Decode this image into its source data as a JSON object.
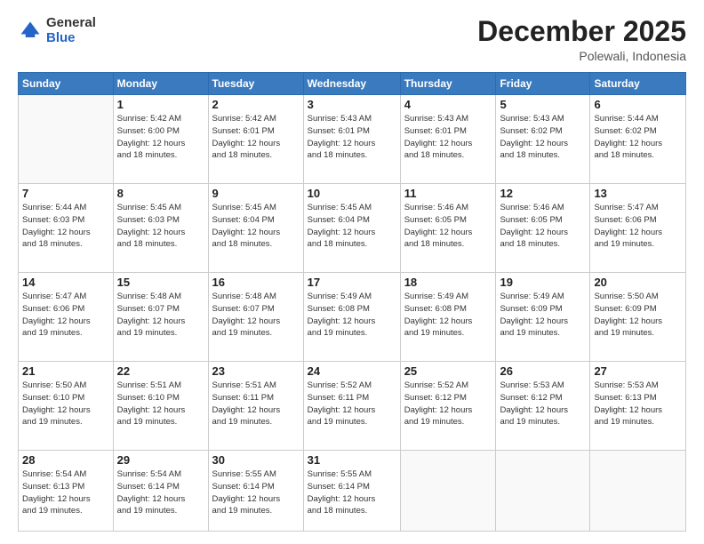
{
  "logo": {
    "general": "General",
    "blue": "Blue"
  },
  "header": {
    "month": "December 2025",
    "location": "Polewali, Indonesia"
  },
  "days_header": [
    "Sunday",
    "Monday",
    "Tuesday",
    "Wednesday",
    "Thursday",
    "Friday",
    "Saturday"
  ],
  "weeks": [
    [
      {
        "day": "",
        "info": ""
      },
      {
        "day": "1",
        "info": "Sunrise: 5:42 AM\nSunset: 6:00 PM\nDaylight: 12 hours\nand 18 minutes."
      },
      {
        "day": "2",
        "info": "Sunrise: 5:42 AM\nSunset: 6:01 PM\nDaylight: 12 hours\nand 18 minutes."
      },
      {
        "day": "3",
        "info": "Sunrise: 5:43 AM\nSunset: 6:01 PM\nDaylight: 12 hours\nand 18 minutes."
      },
      {
        "day": "4",
        "info": "Sunrise: 5:43 AM\nSunset: 6:01 PM\nDaylight: 12 hours\nand 18 minutes."
      },
      {
        "day": "5",
        "info": "Sunrise: 5:43 AM\nSunset: 6:02 PM\nDaylight: 12 hours\nand 18 minutes."
      },
      {
        "day": "6",
        "info": "Sunrise: 5:44 AM\nSunset: 6:02 PM\nDaylight: 12 hours\nand 18 minutes."
      }
    ],
    [
      {
        "day": "7",
        "info": ""
      },
      {
        "day": "8",
        "info": "Sunrise: 5:45 AM\nSunset: 6:03 PM\nDaylight: 12 hours\nand 18 minutes."
      },
      {
        "day": "9",
        "info": "Sunrise: 5:45 AM\nSunset: 6:04 PM\nDaylight: 12 hours\nand 18 minutes."
      },
      {
        "day": "10",
        "info": "Sunrise: 5:45 AM\nSunset: 6:04 PM\nDaylight: 12 hours\nand 18 minutes."
      },
      {
        "day": "11",
        "info": "Sunrise: 5:46 AM\nSunset: 6:05 PM\nDaylight: 12 hours\nand 18 minutes."
      },
      {
        "day": "12",
        "info": "Sunrise: 5:46 AM\nSunset: 6:05 PM\nDaylight: 12 hours\nand 18 minutes."
      },
      {
        "day": "13",
        "info": "Sunrise: 5:47 AM\nSunset: 6:06 PM\nDaylight: 12 hours\nand 19 minutes."
      }
    ],
    [
      {
        "day": "14",
        "info": ""
      },
      {
        "day": "15",
        "info": "Sunrise: 5:48 AM\nSunset: 6:07 PM\nDaylight: 12 hours\nand 19 minutes."
      },
      {
        "day": "16",
        "info": "Sunrise: 5:48 AM\nSunset: 6:07 PM\nDaylight: 12 hours\nand 19 minutes."
      },
      {
        "day": "17",
        "info": "Sunrise: 5:49 AM\nSunset: 6:08 PM\nDaylight: 12 hours\nand 19 minutes."
      },
      {
        "day": "18",
        "info": "Sunrise: 5:49 AM\nSunset: 6:08 PM\nDaylight: 12 hours\nand 19 minutes."
      },
      {
        "day": "19",
        "info": "Sunrise: 5:49 AM\nSunset: 6:09 PM\nDaylight: 12 hours\nand 19 minutes."
      },
      {
        "day": "20",
        "info": "Sunrise: 5:50 AM\nSunset: 6:09 PM\nDaylight: 12 hours\nand 19 minutes."
      }
    ],
    [
      {
        "day": "21",
        "info": ""
      },
      {
        "day": "22",
        "info": "Sunrise: 5:51 AM\nSunset: 6:10 PM\nDaylight: 12 hours\nand 19 minutes."
      },
      {
        "day": "23",
        "info": "Sunrise: 5:51 AM\nSunset: 6:11 PM\nDaylight: 12 hours\nand 19 minutes."
      },
      {
        "day": "24",
        "info": "Sunrise: 5:52 AM\nSunset: 6:11 PM\nDaylight: 12 hours\nand 19 minutes."
      },
      {
        "day": "25",
        "info": "Sunrise: 5:52 AM\nSunset: 6:12 PM\nDaylight: 12 hours\nand 19 minutes."
      },
      {
        "day": "26",
        "info": "Sunrise: 5:53 AM\nSunset: 6:12 PM\nDaylight: 12 hours\nand 19 minutes."
      },
      {
        "day": "27",
        "info": "Sunrise: 5:53 AM\nSunset: 6:13 PM\nDaylight: 12 hours\nand 19 minutes."
      }
    ],
    [
      {
        "day": "28",
        "info": "Sunrise: 5:54 AM\nSunset: 6:13 PM\nDaylight: 12 hours\nand 19 minutes."
      },
      {
        "day": "29",
        "info": "Sunrise: 5:54 AM\nSunset: 6:14 PM\nDaylight: 12 hours\nand 19 minutes."
      },
      {
        "day": "30",
        "info": "Sunrise: 5:55 AM\nSunset: 6:14 PM\nDaylight: 12 hours\nand 19 minutes."
      },
      {
        "day": "31",
        "info": "Sunrise: 5:55 AM\nSunset: 6:14 PM\nDaylight: 12 hours\nand 18 minutes."
      },
      {
        "day": "",
        "info": ""
      },
      {
        "day": "",
        "info": ""
      },
      {
        "day": "",
        "info": ""
      }
    ]
  ],
  "week1_day7_info": "Sunrise: 5:44 AM\nSunset: 6:03 PM\nDaylight: 12 hours\nand 18 minutes.",
  "week2_day14_info": "Sunrise: 5:47 AM\nSunset: 6:06 PM\nDaylight: 12 hours\nand 19 minutes.",
  "week3_day21_info": "Sunrise: 5:50 AM\nSunset: 6:10 PM\nDaylight: 12 hours\nand 19 minutes."
}
